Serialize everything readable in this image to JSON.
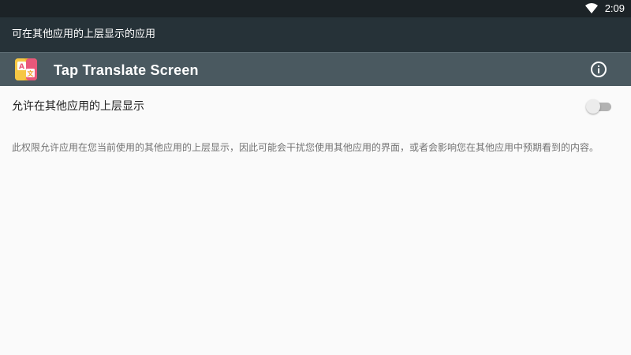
{
  "status_bar": {
    "time": "2:09",
    "wifi_icon": "wifi-icon"
  },
  "app_bar": {
    "title": "可在其他应用的上层显示的应用"
  },
  "app_header": {
    "app_name": "Tap Translate Screen",
    "app_icon": "translate-app-icon",
    "info_icon": "info-icon"
  },
  "permission": {
    "label": "允许在其他应用的上层显示",
    "enabled": false,
    "description": "此权限允许应用在您当前使用的其他应用的上层显示，因此可能会干扰您使用其他应用的界面，或者会影响您在其他应用中预期看到的内容。"
  },
  "colors": {
    "status_bar_bg": "#1c2327",
    "app_bar_bg": "#263238",
    "header_bg": "#4a5960",
    "content_bg": "#fafafa",
    "toggle_track_off": "#b2b2b2",
    "toggle_thumb_off": "#ececec"
  }
}
